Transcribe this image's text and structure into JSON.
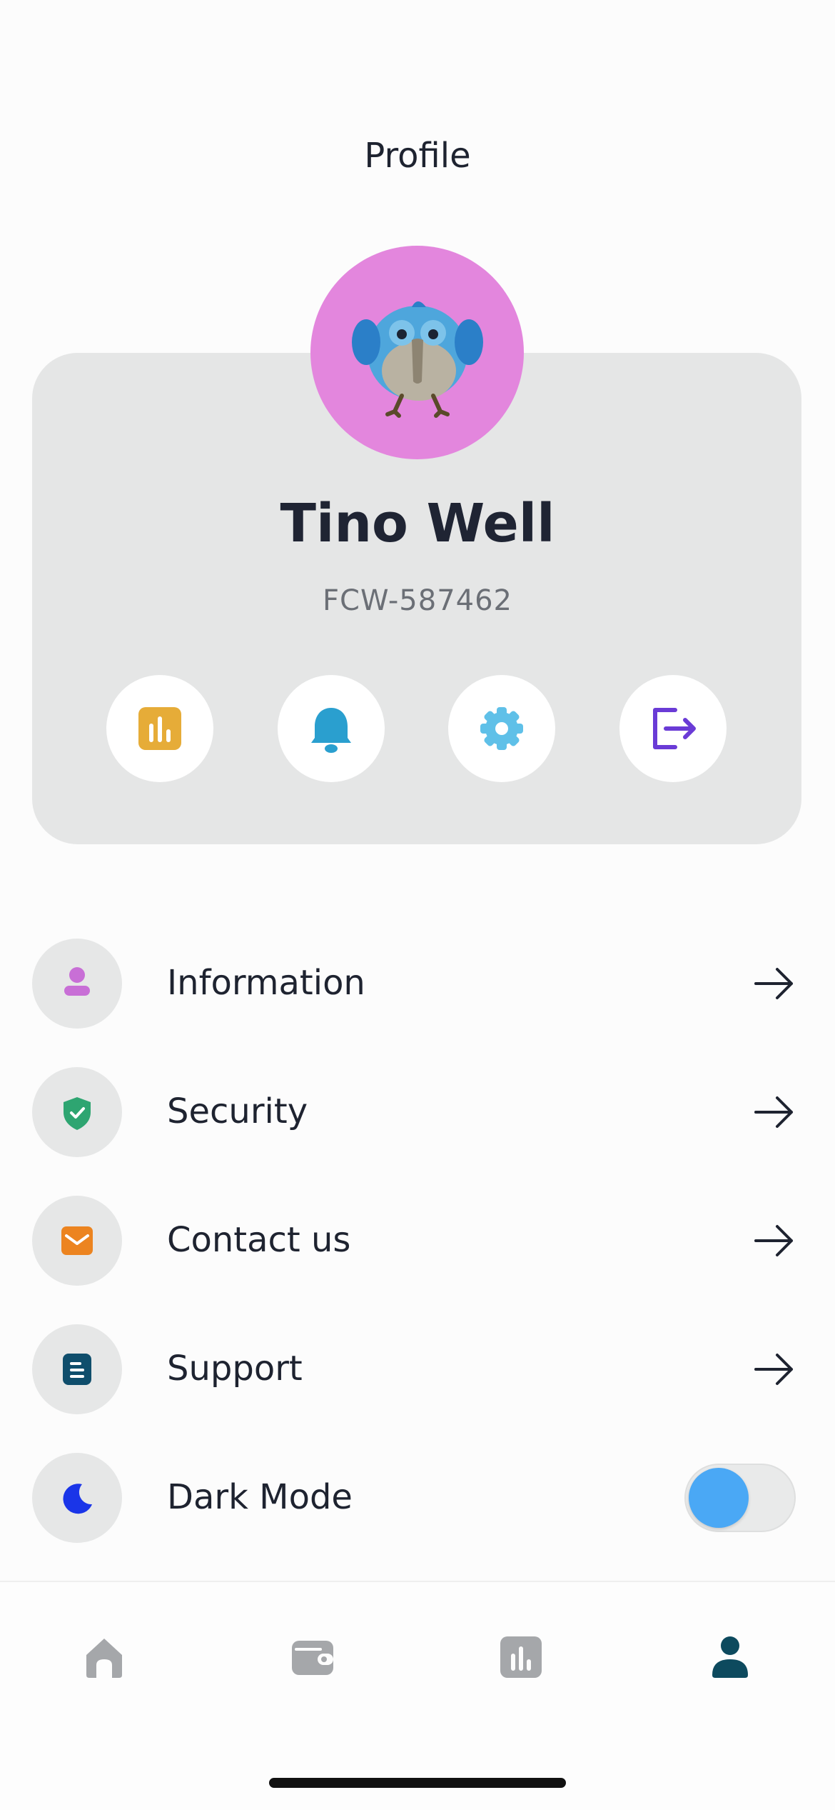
{
  "header": {
    "title": "Profile"
  },
  "profile": {
    "name": "Tino Well",
    "id": "FCW-587462",
    "avatar_icon": "bird-avatar-icon",
    "avatar_bg": "#e386dd"
  },
  "quick_actions": [
    {
      "icon": "chart-icon",
      "color": "#e6ac38"
    },
    {
      "icon": "bell-icon",
      "color": "#2a9fcf"
    },
    {
      "icon": "gear-icon",
      "color": "#5fc0e8"
    },
    {
      "icon": "logout-icon",
      "color": "#6a3bd6"
    }
  ],
  "menu": {
    "items": [
      {
        "label": "Information",
        "icon": "user-icon",
        "icon_color": "#c86fd6"
      },
      {
        "label": "Security",
        "icon": "shield-icon",
        "icon_color": "#2ea571"
      },
      {
        "label": "Contact us",
        "icon": "mail-icon",
        "icon_color": "#ec8420"
      },
      {
        "label": "Support",
        "icon": "document-icon",
        "icon_color": "#0f4e6c"
      }
    ],
    "dark_mode": {
      "label": "Dark Mode",
      "icon": "moon-icon",
      "icon_color": "#1a35e8",
      "toggle_color": "#4aa8f5"
    }
  },
  "tabbar": {
    "tabs": [
      {
        "icon": "home-icon",
        "active": false
      },
      {
        "icon": "wallet-icon",
        "active": false
      },
      {
        "icon": "stats-icon",
        "active": false
      },
      {
        "icon": "profile-icon",
        "active": true
      }
    ],
    "active_color": "#0d4a5e",
    "inactive_color": "#a5a7aa"
  }
}
